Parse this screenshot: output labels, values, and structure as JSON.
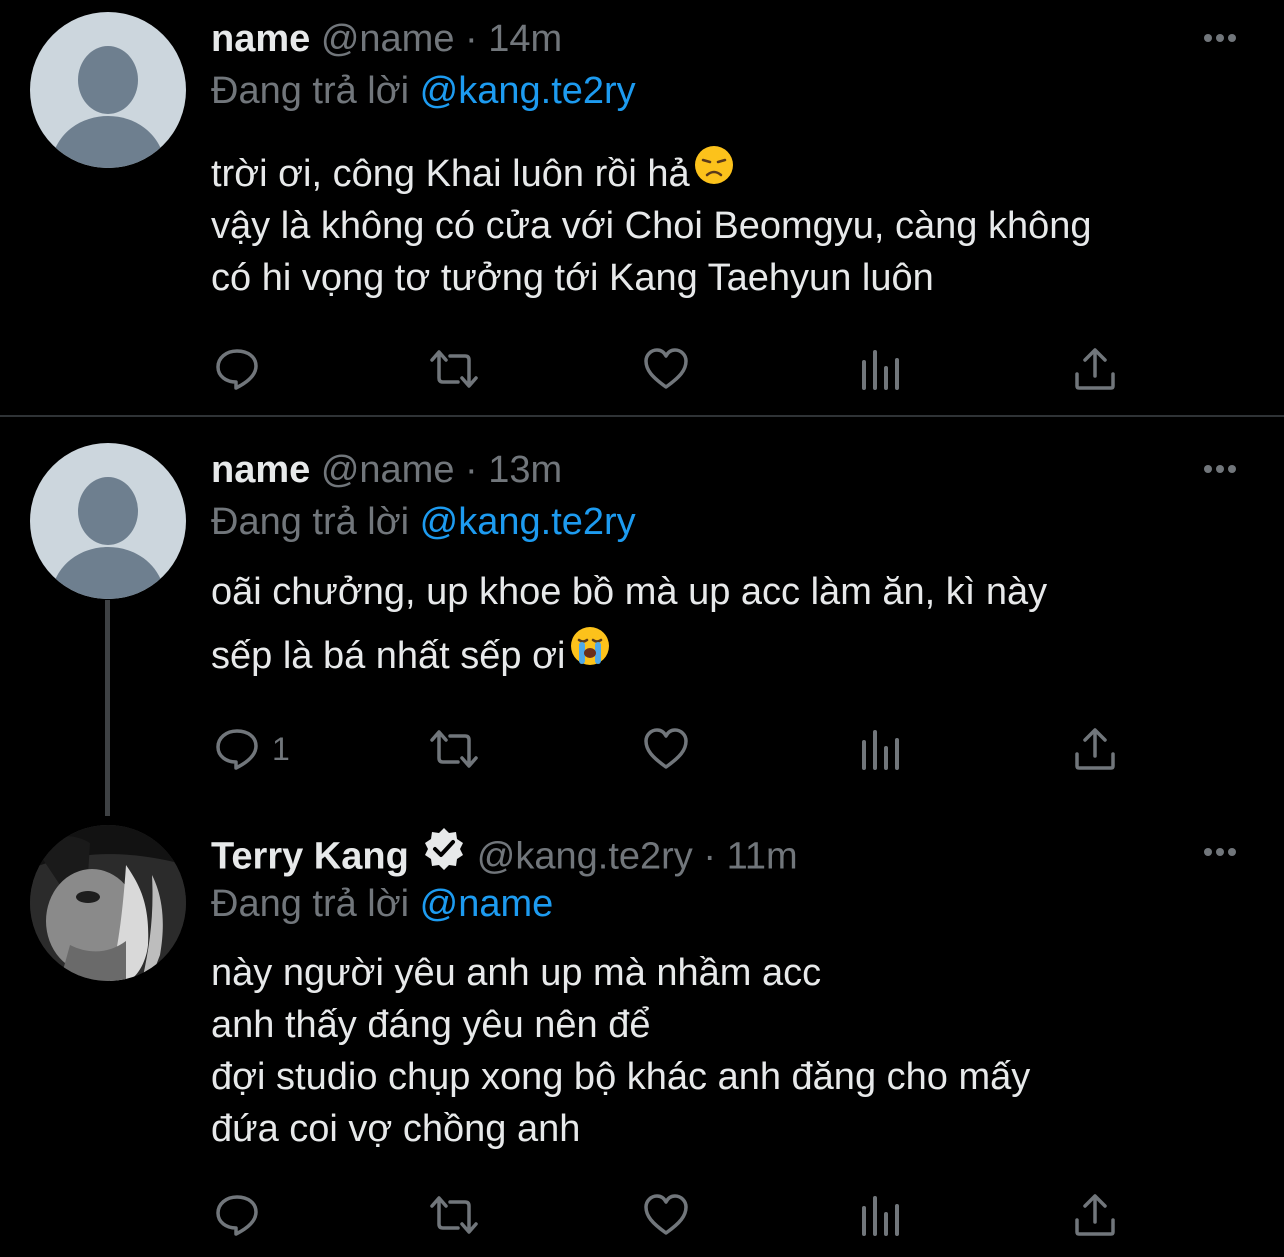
{
  "tweets": [
    {
      "display_name": "name",
      "handle": "@name",
      "dot": "·",
      "time": "14m",
      "reply_label": "Đang trả lời",
      "reply_to": "@kang.te2ry",
      "lines": [
        "trời ơi, công Khai luôn rồi hả",
        "vậy là không có cửa với Choi Beomgyu, càng không",
        "có hi vọng tơ tưởng tới Kang Taehyun luôn"
      ],
      "emoji_icon": "disappointed-face-icon",
      "reply_count": ""
    },
    {
      "display_name": "name",
      "handle": "@name",
      "dot": "·",
      "time": "13m",
      "reply_label": "Đang trả lời",
      "reply_to": "@kang.te2ry",
      "lines": [
        "oãi chưởng, up khoe bồ mà up acc làm ăn, kì này",
        "sếp là bá nhất sếp ơi"
      ],
      "emoji_icon": "loudly-crying-face-icon",
      "reply_count": "1"
    },
    {
      "display_name": "Terry Kang",
      "verified": true,
      "handle": "@kang.te2ry",
      "dot": "·",
      "time": "11m",
      "reply_label": "Đang trả lời",
      "reply_to": "@name",
      "lines": [
        "này người yêu anh up mà nhầm acc",
        "anh thấy đáng yêu nên để",
        "đợi studio chụp xong bộ khác anh đăng cho mấy",
        "đứa coi vợ chồng anh"
      ],
      "reply_count": ""
    }
  ],
  "colors": {
    "background": "#000000",
    "text": "#e7e9ea",
    "muted": "#71767b",
    "link": "#1d9bf0",
    "separator": "#2f3336"
  },
  "icons": [
    "reply-icon",
    "retweet-icon",
    "like-icon",
    "views-icon",
    "share-icon",
    "more-icon",
    "verified-badge-icon"
  ]
}
